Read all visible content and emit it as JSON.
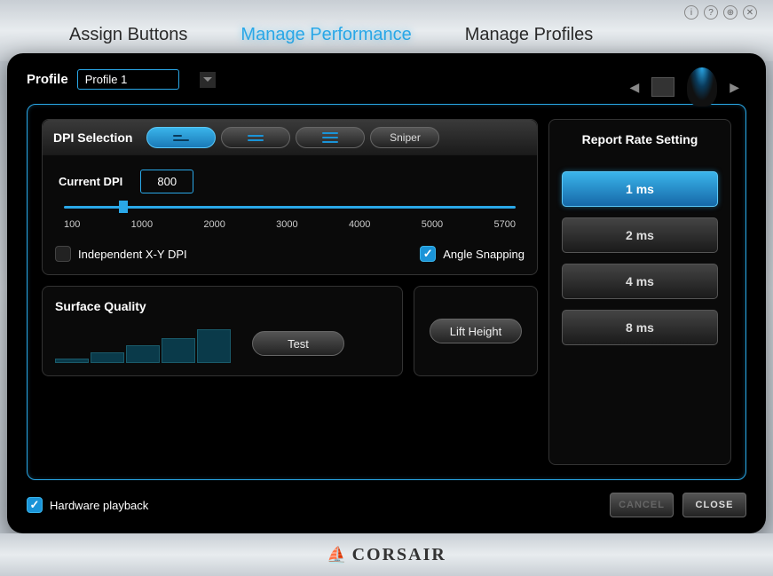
{
  "top_icons": [
    "info-icon",
    "help-icon",
    "globe-icon",
    "close-icon"
  ],
  "tabs": {
    "assign": "Assign Buttons",
    "manage_perf": "Manage Performance",
    "manage_profiles": "Manage Profiles",
    "active": "manage_perf"
  },
  "profile": {
    "label": "Profile",
    "selected": "Profile 1"
  },
  "dpi": {
    "title": "DPI Selection",
    "sniper": "Sniper",
    "current_label": "Current DPI",
    "current_value": "800",
    "ticks": [
      "100",
      "1000",
      "2000",
      "3000",
      "4000",
      "5000",
      "5700"
    ],
    "independent_xy": "Independent X-Y DPI",
    "angle_snapping": "Angle Snapping",
    "independent_checked": false,
    "angle_checked": true
  },
  "surface": {
    "title": "Surface Quality",
    "test": "Test"
  },
  "lift": {
    "button": "Lift Height"
  },
  "report": {
    "title": "Report Rate Setting",
    "rates": [
      "1 ms",
      "2 ms",
      "4 ms",
      "8 ms"
    ],
    "active_index": 0
  },
  "footer": {
    "hw_playback": "Hardware playback",
    "hw_checked": true,
    "cancel": "CANCEL",
    "close": "CLOSE"
  },
  "brand": "CORSAIR"
}
